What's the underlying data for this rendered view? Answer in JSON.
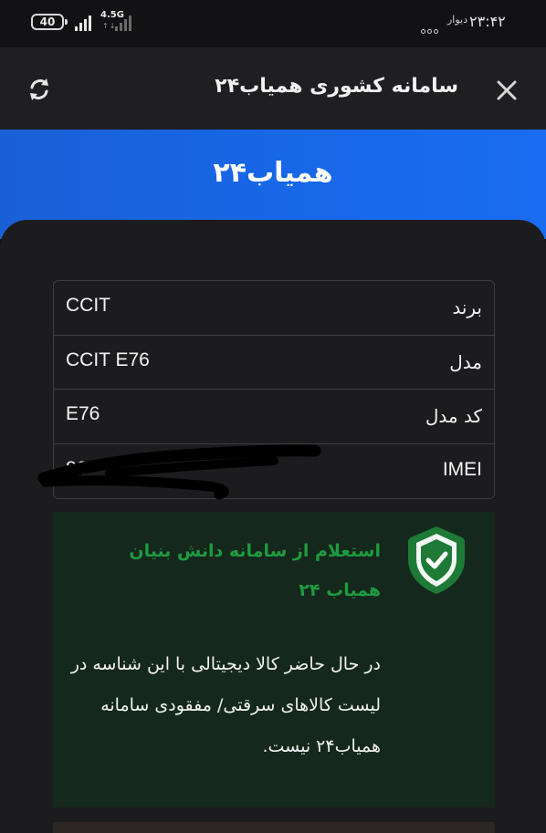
{
  "status_bar": {
    "battery": "40",
    "network": "4.5G",
    "carrier_app": "دیوار",
    "time": "۲۳:۴۲"
  },
  "app_bar": {
    "title": "سامانه کشوری همیاب۲۴",
    "close_icon": "close-icon",
    "refresh_icon": "refresh-icon"
  },
  "hero": {
    "title": "همیاب۲۴"
  },
  "device_info": {
    "rows": [
      {
        "label": "برند",
        "value": "CCIT"
      },
      {
        "label": "مدل",
        "value": "CCIT E76"
      },
      {
        "label": "کد مدل",
        "value": "E76"
      },
      {
        "label": "IMEI",
        "value": "86"
      }
    ]
  },
  "result": {
    "icon": "shield-check-icon",
    "title": "استعلام از سامانه دانش بنیان همیاب ۲۴",
    "message": "در حال حاضر کالا دیجیتالی با این شناسه در لیست کالاهای سرقتی/ مفقودی سامانه همیاب۲۴ نیست.",
    "colors": {
      "title": "#1e9b3f",
      "background": "#15281d",
      "shield": "#1e7a36"
    }
  },
  "colors": {
    "hero_blue": "#1767e6",
    "card_bg": "#1c1c1e",
    "app_bar_bg": "#1f1f22"
  }
}
